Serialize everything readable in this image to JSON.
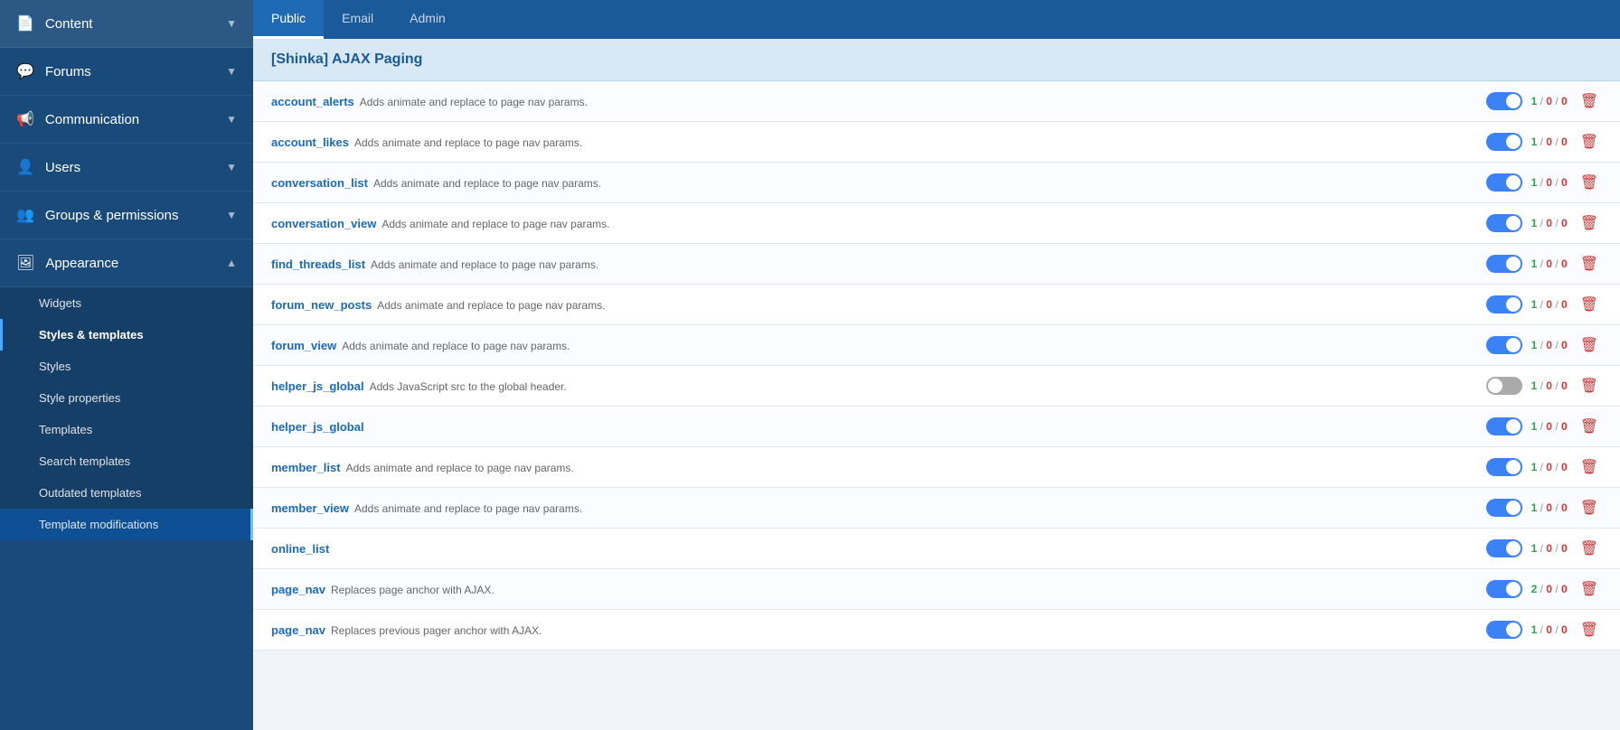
{
  "sidebar": {
    "items": [
      {
        "id": "content",
        "label": "Content",
        "icon": "📄",
        "expanded": false
      },
      {
        "id": "forums",
        "label": "Forums",
        "icon": "💬",
        "expanded": false
      },
      {
        "id": "communication",
        "label": "Communication",
        "icon": "📢",
        "expanded": false
      },
      {
        "id": "users",
        "label": "Users",
        "icon": "👤",
        "expanded": false
      },
      {
        "id": "groups",
        "label": "Groups & permissions",
        "icon": "👥",
        "expanded": false
      },
      {
        "id": "appearance",
        "label": "Appearance",
        "icon": "🖼",
        "expanded": true
      }
    ],
    "sub_items": [
      {
        "id": "widgets",
        "label": "Widgets",
        "active": false,
        "highlighted": false
      },
      {
        "id": "styles-templates",
        "label": "Styles & templates",
        "active": true,
        "highlighted": false
      },
      {
        "id": "styles",
        "label": "Styles",
        "active": false,
        "highlighted": false
      },
      {
        "id": "style-properties",
        "label": "Style properties",
        "active": false,
        "highlighted": false
      },
      {
        "id": "templates",
        "label": "Templates",
        "active": false,
        "highlighted": false
      },
      {
        "id": "search-templates",
        "label": "Search templates",
        "active": false,
        "highlighted": false
      },
      {
        "id": "outdated-templates",
        "label": "Outdated templates",
        "active": false,
        "highlighted": false
      },
      {
        "id": "template-modifications",
        "label": "Template modifications",
        "active": false,
        "highlighted": true
      }
    ]
  },
  "tabs": [
    {
      "id": "public",
      "label": "Public",
      "active": true
    },
    {
      "id": "email",
      "label": "Email",
      "active": false
    },
    {
      "id": "admin",
      "label": "Admin",
      "active": false
    }
  ],
  "section_title": "[Shinka] AJAX Paging",
  "templates": [
    {
      "name": "account_alerts",
      "desc": "Adds animate and replace to page nav params.",
      "enabled": true,
      "counts": [
        1,
        0,
        0
      ]
    },
    {
      "name": "account_likes",
      "desc": "Adds animate and replace to page nav params.",
      "enabled": true,
      "counts": [
        1,
        0,
        0
      ]
    },
    {
      "name": "conversation_list",
      "desc": "Adds animate and replace to page nav params.",
      "enabled": true,
      "counts": [
        1,
        0,
        0
      ]
    },
    {
      "name": "conversation_view",
      "desc": "Adds animate and replace to page nav params.",
      "enabled": true,
      "counts": [
        1,
        0,
        0
      ]
    },
    {
      "name": "find_threads_list",
      "desc": "Adds animate and replace to page nav params.",
      "enabled": true,
      "counts": [
        1,
        0,
        0
      ]
    },
    {
      "name": "forum_new_posts",
      "desc": "Adds animate and replace to page nav params.",
      "enabled": true,
      "counts": [
        1,
        0,
        0
      ]
    },
    {
      "name": "forum_view",
      "desc": "Adds animate and replace to page nav params.",
      "enabled": true,
      "counts": [
        1,
        0,
        0
      ]
    },
    {
      "name": "helper_js_global",
      "desc": "Adds JavaScript src to the global header.",
      "enabled": false,
      "counts": [
        1,
        0,
        0
      ]
    },
    {
      "name": "helper_js_global",
      "desc": "",
      "enabled": true,
      "counts": [
        1,
        0,
        0
      ]
    },
    {
      "name": "member_list",
      "desc": "Adds animate and replace to page nav params.",
      "enabled": true,
      "counts": [
        1,
        0,
        0
      ]
    },
    {
      "name": "member_view",
      "desc": "Adds animate and replace to page nav params.",
      "enabled": true,
      "counts": [
        1,
        0,
        0
      ]
    },
    {
      "name": "online_list",
      "desc": "",
      "enabled": true,
      "counts": [
        1,
        0,
        0
      ]
    },
    {
      "name": "page_nav",
      "desc": "Replaces page anchor with AJAX.",
      "enabled": true,
      "counts": [
        2,
        0,
        0
      ]
    },
    {
      "name": "page_nav",
      "desc": "Replaces previous pager anchor with AJAX.",
      "enabled": true,
      "counts": [
        1,
        0,
        0
      ]
    }
  ]
}
